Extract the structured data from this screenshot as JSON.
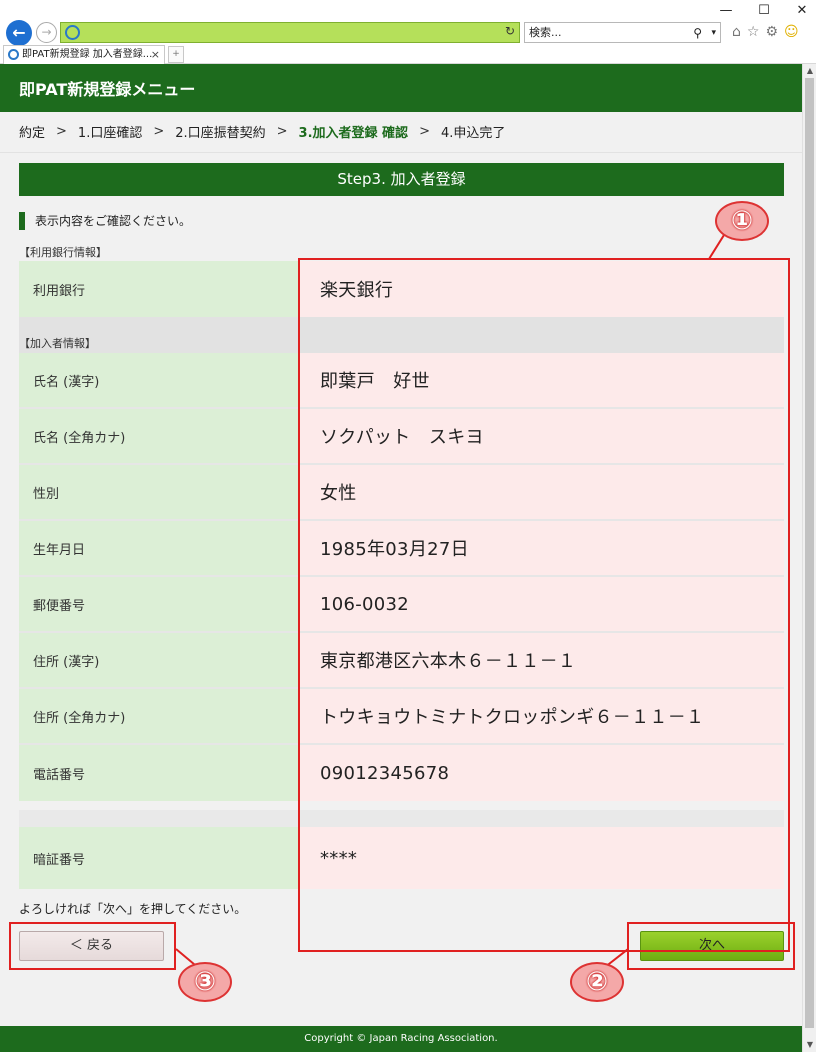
{
  "browser": {
    "tab_title": "即PAT新規登録 加入者登録...",
    "tab_close": "×",
    "search_placeholder": "検索...",
    "back": "←",
    "forward": "→",
    "refresh": "↻",
    "search_icon": "⚲",
    "search_dropdown": "▾",
    "window_min": "—",
    "window_max": "☐",
    "window_close": "✕",
    "icons": [
      "home-icon",
      "star-icon",
      "gear-icon",
      "smiley-icon"
    ],
    "icon_glyphs": [
      "⌂",
      "☆",
      "⚙",
      "☺"
    ]
  },
  "header": {
    "title": "即PAT新規登録メニュー"
  },
  "breadcrumb": {
    "items": [
      "約定",
      "1.口座確認",
      "2.口座振替契約",
      "3.加入者登録 確認",
      "4.申込完了"
    ],
    "separator": ">"
  },
  "step": {
    "title": "Step3. 加入者登録"
  },
  "notice": "表示内容をご確認ください。",
  "bank_section": {
    "label": "【利用銀行情報】",
    "rows": [
      {
        "label": "利用銀行",
        "value": "楽天銀行"
      }
    ]
  },
  "applicant_section": {
    "label": "【加入者情報】",
    "rows": [
      {
        "label": "氏名 (漢字)",
        "value": "即葉戸　好世"
      },
      {
        "label": "氏名 (全角カナ)",
        "value": "ソクパット　スキヨ"
      },
      {
        "label": "性別",
        "value": "女性"
      },
      {
        "label": "生年月日",
        "value": "1985年03月27日"
      },
      {
        "label": "郵便番号",
        "value": "106-0032"
      },
      {
        "label": "住所 (漢字)",
        "value": "東京都港区六本木６－１１－１"
      },
      {
        "label": "住所 (全角カナ)",
        "value": "トウキョウトミナトクロッポンギ６－１１－１"
      },
      {
        "label": "電話番号",
        "value": "09012345678"
      }
    ]
  },
  "pin_section": {
    "rows": [
      {
        "label": "暗証番号",
        "value": "****"
      }
    ]
  },
  "confirm_text": "よろしければ「次へ」を押してください。",
  "buttons": {
    "back": "＜ 戻る",
    "next": "次へ"
  },
  "footer": "Copyright © Japan Racing Association.",
  "annotations": [
    "①",
    "②",
    "③"
  ],
  "colors": {
    "brand_green": "#1d6b1d",
    "label_bg": "#dcefd6",
    "value_bg": "#fdeaea",
    "callout_red": "#e02020"
  }
}
